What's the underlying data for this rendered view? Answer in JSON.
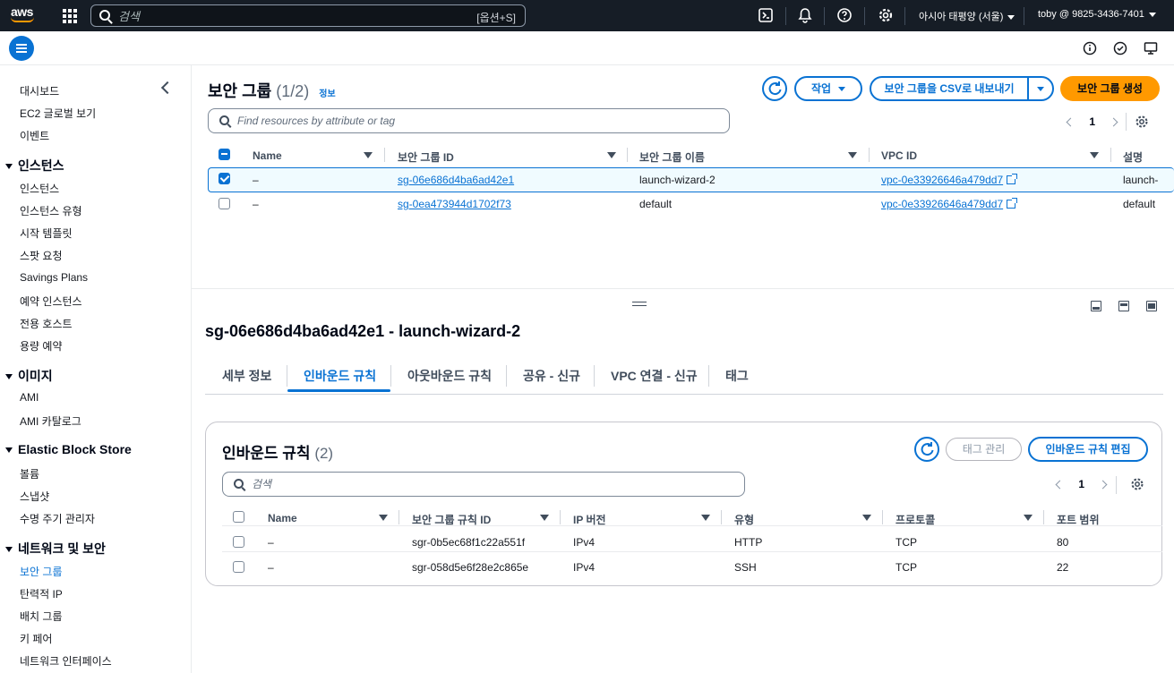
{
  "topnav": {
    "logo_text": "aws",
    "search_placeholder": "검색",
    "search_shortcut": "[옵션+S]",
    "region": "아시아 태평양 (서울)",
    "account": "toby @ 9825-3436-7401",
    "icons": [
      "grid-icon",
      "cloudshell-icon",
      "bell-icon",
      "help-icon",
      "gear-icon"
    ]
  },
  "sidebar": {
    "items_top": [
      "대시보드",
      "EC2 글로벌 보기",
      "이벤트"
    ],
    "sections": [
      {
        "title": "인스턴스",
        "items": [
          "인스턴스",
          "인스턴스 유형",
          "시작 템플릿",
          "스팟 요청",
          "Savings Plans",
          "예약 인스턴스",
          "전용 호스트",
          "용량 예약"
        ]
      },
      {
        "title": "이미지",
        "items": [
          "AMI",
          "AMI 카탈로그"
        ]
      },
      {
        "title": "Elastic Block Store",
        "items": [
          "볼륨",
          "스냅샷",
          "수명 주기 관리자"
        ]
      },
      {
        "title": "네트워크 및 보안",
        "items": [
          "보안 그룹",
          "탄력적 IP",
          "배치 그룹",
          "키 페어",
          "네트워크 인터페이스"
        ]
      }
    ],
    "active": "보안 그룹"
  },
  "header": {
    "title": "보안 그룹",
    "count": "(1/2)",
    "info": "정보",
    "actions_label": "작업",
    "export_label": "보안 그룹을 CSV로 내보내기",
    "create_label": "보안 그룹 생성",
    "filter_placeholder": "Find resources by attribute or tag",
    "page": "1"
  },
  "sg_table": {
    "columns": [
      "Name",
      "보안 그룹 ID",
      "보안 그룹 이름",
      "VPC ID",
      "설명"
    ],
    "rows": [
      {
        "name": "–",
        "id": "sg-06e686d4ba6ad42e1",
        "group_name": "launch-wizard-2",
        "vpc": "vpc-0e33926646a479dd7",
        "desc": "launch-",
        "selected": true
      },
      {
        "name": "–",
        "id": "sg-0ea473944d1702f73",
        "group_name": "default",
        "vpc": "vpc-0e33926646a479dd7",
        "desc": "default",
        "selected": false
      }
    ]
  },
  "detail": {
    "title": "sg-06e686d4ba6ad42e1 - launch-wizard-2",
    "tabs": [
      "세부 정보",
      "인바운드 규칙",
      "아웃바운드 규칙",
      "공유 - 신규",
      "VPC 연결 - 신규",
      "태그"
    ],
    "active_tab": "인바운드 규칙"
  },
  "inbound": {
    "title": "인바운드 규칙",
    "count": "(2)",
    "manage_tags_label": "태그 관리",
    "edit_label": "인바운드 규칙 편집",
    "search_placeholder": "검색",
    "page": "1",
    "columns": [
      "Name",
      "보안 그룹 규칙 ID",
      "IP 버전",
      "유형",
      "프로토콜",
      "포트 범위"
    ],
    "rows": [
      {
        "name": "–",
        "rule_id": "sgr-0b5ec68f1c22a551f",
        "ip": "IPv4",
        "type": "HTTP",
        "protocol": "TCP",
        "port": "80"
      },
      {
        "name": "–",
        "rule_id": "sgr-058d5e6f28e2c865e",
        "ip": "IPv4",
        "type": "SSH",
        "protocol": "TCP",
        "port": "22"
      }
    ]
  },
  "colors": {
    "accent": "#0972d3",
    "primary_button": "#ff9900",
    "nav_bg": "#161d26"
  }
}
